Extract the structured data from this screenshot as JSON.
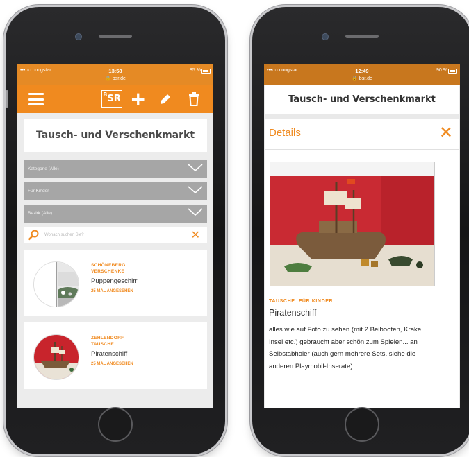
{
  "left_phone": {
    "status": {
      "carrier": "•••○○ congstar",
      "time": "13:58",
      "url": "bsr.de",
      "battery": "85 %"
    },
    "logo": {
      "top": "B",
      "sup": "S",
      "bottom": "R"
    },
    "app_title": "Tausch- und Verschenkmarkt",
    "filters": [
      "Kategorie (Alle)",
      "Für Kinder",
      "Bezirk (Alle)"
    ],
    "search": {
      "placeholder": "Wonach suchen Sie?"
    },
    "listings": [
      {
        "location": "SCHÖNEBERG",
        "type": "VERSCHENKE",
        "title": "Puppengeschirr",
        "views": "25 MAL ANGESEHEN"
      },
      {
        "location": "ZEHLENDORF",
        "type": "TAUSCHE",
        "title": "Piratenschiff",
        "views": "25 MAL ANGESEHEN"
      }
    ]
  },
  "right_phone": {
    "status": {
      "carrier": "•••○○ congstar",
      "time": "12:49",
      "url": "bsr.de",
      "battery": "90 %"
    },
    "app_title": "Tausch- und Verschenkmarkt",
    "details_label": "Details",
    "category": "TAUSCHE: FÜR KINDER",
    "item_name": "Piratenschiff",
    "description": "alles wie auf Foto zu sehen (mit 2 Beibooten, Krake, Insel etc.) gebraucht aber schön zum Spielen... an Selbstabholer (auch gern mehrere Sets, siehe die anderen Playmobil-Inserate)"
  },
  "colors": {
    "accent": "#f08a1f",
    "status_bar_right": "#c8771e",
    "filter_bg": "#a6a6a6",
    "screen_bg": "#ececec"
  },
  "icons": [
    "menu-icon",
    "add-icon",
    "edit-icon",
    "trash-icon",
    "search-icon",
    "close-icon",
    "chevron-down-icon"
  ]
}
